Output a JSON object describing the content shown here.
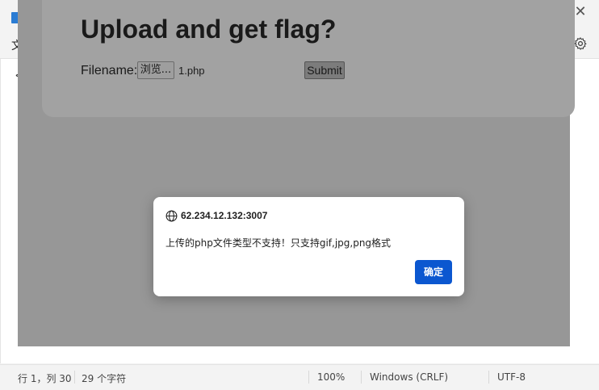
{
  "notepad": {
    "menu_file": "文",
    "close_glyph": "✕",
    "editor_text": "<",
    "status": {
      "position": "行 1，列 30",
      "char_count": "29 个字符",
      "zoom": "100%",
      "line_ending": "Windows (CRLF)",
      "encoding": "UTF-8"
    }
  },
  "page": {
    "heading": "Upload and get flag?",
    "file_label": "Filename:",
    "browse_label": "浏览...",
    "file_name": "1.php",
    "submit_label": "Submit"
  },
  "dialog": {
    "origin": "62.234.12.132:3007",
    "message": "上传的php文件类型不支持！只支持gif,jpg,png格式",
    "ok_label": "确定",
    "ok_color": "#0b57d0"
  }
}
